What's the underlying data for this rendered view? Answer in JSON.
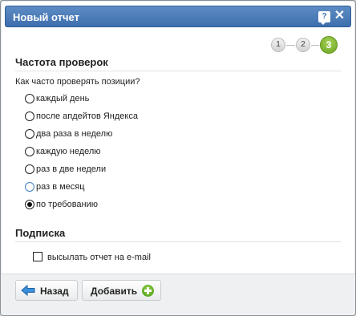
{
  "dialog": {
    "title": "Новый отчет",
    "help_icon": "help-speech-icon",
    "close_icon": "close-icon"
  },
  "steps": [
    "1",
    "2",
    "3"
  ],
  "active_step": 3,
  "frequency": {
    "title": "Частота проверок",
    "question": "Как часто проверять позиции?",
    "options": [
      {
        "label": "каждый день",
        "checked": false
      },
      {
        "label": "после апдейтов Яндекса",
        "checked": false
      },
      {
        "label": "два раза в неделю",
        "checked": false
      },
      {
        "label": "каждую неделю",
        "checked": false
      },
      {
        "label": "раз в две недели",
        "checked": false
      },
      {
        "label": "раз в месяц",
        "checked": false
      },
      {
        "label": "по требованию",
        "checked": true
      }
    ]
  },
  "subscription": {
    "title": "Подписка",
    "email_label": "высылать отчет на e-mail",
    "email_checked": false
  },
  "footer": {
    "back_label": "Назад",
    "add_label": "Добавить"
  },
  "colors": {
    "titlebar": "#4a7cb9",
    "accent_green": "#6aa31f"
  }
}
